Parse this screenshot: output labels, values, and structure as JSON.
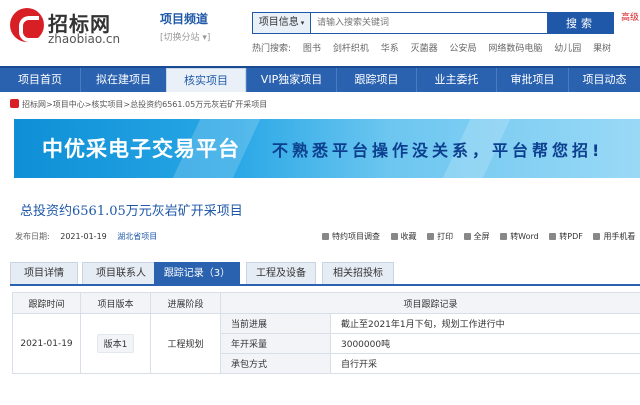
{
  "header": {
    "logo_cn": "招标网",
    "logo_en": "zhaobiao.cn",
    "channel_title": "项目频道",
    "channel_switch": "[切换分站 ▾]",
    "search_scope": "项目信息",
    "search_placeholder": "请输入搜索关键词",
    "search_button": "搜索",
    "hot_link": "高级",
    "hot_label": "热门搜索:",
    "hot_terms": [
      "图书",
      "剑杆织机",
      "华系",
      "灭菌器",
      "公安局",
      "网络数码电脑",
      "幼儿园",
      "果树"
    ]
  },
  "nav": {
    "items": [
      "项目首页",
      "拟在建项目",
      "核实项目",
      "VIP独家项目",
      "跟踪项目",
      "业主委托",
      "审批项目",
      "项目动态"
    ],
    "active_index": 2
  },
  "breadcrumb": {
    "items": [
      "招标网",
      "项目中心",
      "核实项目",
      "总投资约6561.05万元灰岩矿开采项目"
    ],
    "separator": ">"
  },
  "banner": {
    "headline": "中优采电子交易平台",
    "slogan": "不熟悉平台操作没关系，平台帮您招!"
  },
  "project": {
    "title": "总投资约6561.05万元灰岩矿开采项目",
    "publish_label": "发布日期:",
    "publish_date": "2021-01-19",
    "region": "湖北省项目"
  },
  "tools": [
    {
      "icon": "star-icon",
      "label": "特约项目调查"
    },
    {
      "icon": "bookmark-icon",
      "label": "收藏"
    },
    {
      "icon": "printer-icon",
      "label": "打印"
    },
    {
      "icon": "fullscreen-icon",
      "label": "全屏"
    },
    {
      "icon": "word-icon",
      "label": "转Word"
    },
    {
      "icon": "pdf-icon",
      "label": "转PDF"
    },
    {
      "icon": "phone-icon",
      "label": "用手机看"
    }
  ],
  "tabs": {
    "items": [
      "项目详情",
      "项目联系人",
      "跟踪记录（3）",
      "工程及设备",
      "相关招投标"
    ],
    "active_index": 2
  },
  "table": {
    "headers": [
      "跟踪时间",
      "项目版本",
      "进展阶段",
      "项目跟踪记录"
    ],
    "row": {
      "date": "2021-01-19",
      "version": "版本1",
      "stage": "工程规划",
      "details": [
        {
          "label": "当前进展",
          "value": "截止至2021年1月下旬，规划工作进行中"
        },
        {
          "label": "年开采量",
          "value": "3000000吨"
        },
        {
          "label": "承包方式",
          "value": "自行开采"
        }
      ]
    }
  },
  "colors": {
    "brand_blue": "#2a62b0",
    "brand_red": "#d81f26",
    "link_blue": "#1f58a8"
  }
}
